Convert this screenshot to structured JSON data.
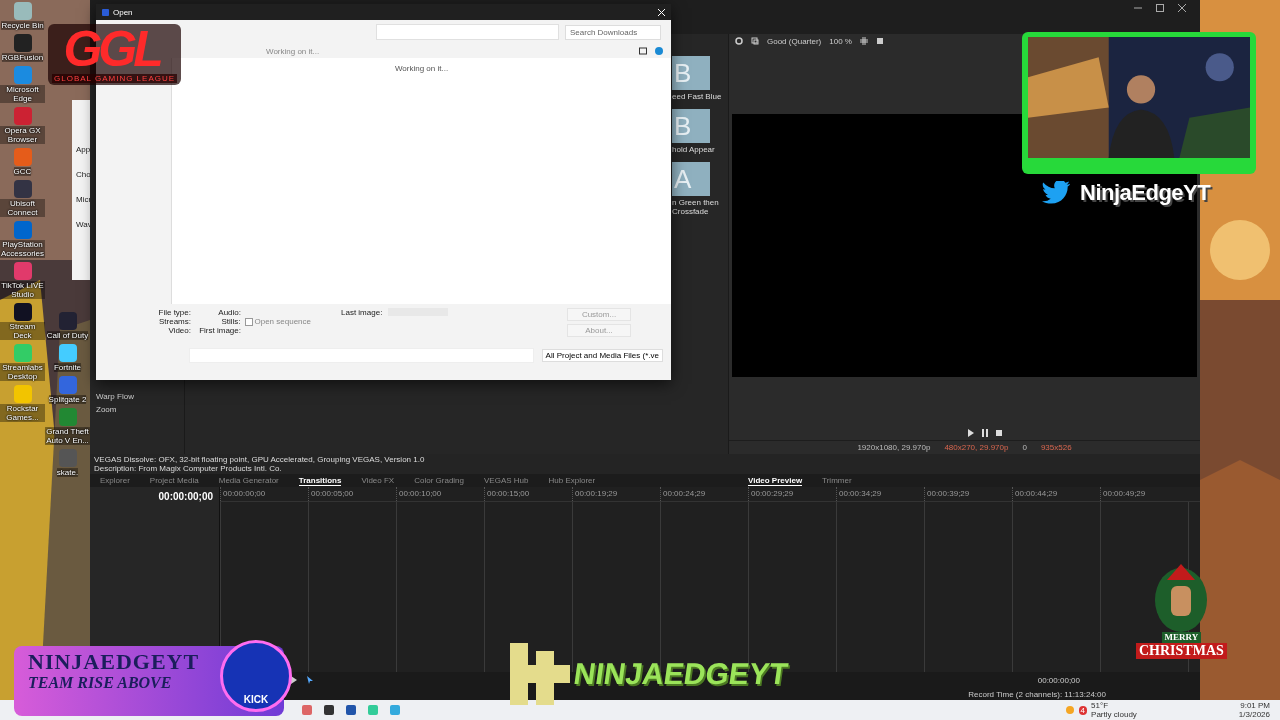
{
  "desktop": {
    "columns": [
      {
        "icons": [
          {
            "label": "Recycle Bin"
          },
          {
            "label": "RGBFusion"
          },
          {
            "label": "Microsoft Edge"
          },
          {
            "label": "Opera GX Browser"
          },
          {
            "label": "GCC"
          },
          {
            "label": "Ubisoft Connect"
          },
          {
            "label": "PlayStation Accessories"
          },
          {
            "label": "TikTok LIVE Studio"
          },
          {
            "label": "Stream Deck"
          },
          {
            "label": "Streamlabs Desktop"
          },
          {
            "label": "Rockstar Games..."
          }
        ]
      },
      {
        "icons": [
          {
            "label": "Call of Duty"
          },
          {
            "label": "Fortnite"
          },
          {
            "label": "Splitgate 2"
          },
          {
            "label": "Grand Theft Auto V En..."
          },
          {
            "label": "skate."
          }
        ]
      }
    ]
  },
  "settings_window": {
    "texts": [
      "App",
      "Cho",
      "Micr",
      "Wav"
    ]
  },
  "vegas": {
    "toolbar": {
      "quality": "Good (Quarter)",
      "zoom": "100 %"
    },
    "transitions": [
      {
        "label": "eed Fast Blue",
        "glyph": "B"
      },
      {
        "label": "hold Appear",
        "glyph": "B"
      },
      {
        "label": "n Green then Crossfade",
        "glyph": "A"
      }
    ],
    "fx_list": [
      "Warp Flow",
      "Zoom"
    ],
    "info": [
      "VEGAS Dissolve: OFX, 32-bit floating point, GPU Accelerated, Grouping VEGAS, Version 1.0",
      "Description: From Magix Computer Products Intl. Co."
    ],
    "tabs": [
      {
        "label": "Explorer",
        "selected": false
      },
      {
        "label": "Project Media",
        "selected": false
      },
      {
        "label": "Media Generator",
        "selected": false
      },
      {
        "label": "Transitions",
        "selected": true
      },
      {
        "label": "Video FX",
        "selected": false
      },
      {
        "label": "Color Grading",
        "selected": false
      },
      {
        "label": "VEGAS Hub",
        "selected": false
      },
      {
        "label": "Hub Explorer",
        "selected": false
      }
    ],
    "preview_tabs": [
      {
        "label": "Video Preview",
        "selected": true
      },
      {
        "label": "Trimmer",
        "selected": false
      }
    ],
    "preview_stats": [
      "1920x1080, 29.970p",
      "480x270, 29.970p",
      "0",
      "935x526"
    ],
    "timecode": "00:00:00;00",
    "ruler": [
      "00:00:00;00",
      "00:00:05;00",
      "00:00:10;00",
      "00:00:15;00",
      "00:00:19;29",
      "00:00:24;29",
      "00:00:29;29",
      "00:00:34;29",
      "00:00:39;29",
      "00:00:44;29",
      "00:00:49;29"
    ],
    "end_timecode": "00:00:00;00",
    "record_time": "Record Time (2 channels): 11:13:24:00"
  },
  "open_dialog": {
    "title": "Open",
    "search": {
      "placeholder": "Search Downloads"
    },
    "status": "Working on it...",
    "status_behind": "Working on it...",
    "fields_left": [
      "File type:",
      "Streams:",
      "Video:"
    ],
    "fields_mid": [
      "Audio:",
      "Stills:",
      "First image:"
    ],
    "open_sequence": {
      "label": "Open sequence",
      "checked": false
    },
    "last_image": "Last image:",
    "buttons": [
      "Custom...",
      "About..."
    ],
    "filter": "All Project and Media Files (*.ve"
  },
  "taskbar": {
    "weather": {
      "temp": "51°F",
      "text": "Partly cloudy",
      "badge": "4"
    },
    "time": "9:01 PM",
    "date": "1/3/2026"
  },
  "overlays": {
    "league": {
      "logo": "GGL",
      "caption": "GLOBAL GAMING LEAGUE"
    },
    "twitter_handle": "NinjaEdgeYT",
    "badge": {
      "title": "NINJAEDGEYT",
      "subtitle": "TEAM RISE ABOVE",
      "platform": "KICK"
    },
    "center_handle": "NINJAEDGEYT",
    "holiday": [
      "MERRY",
      "CHRISTMAS"
    ]
  }
}
